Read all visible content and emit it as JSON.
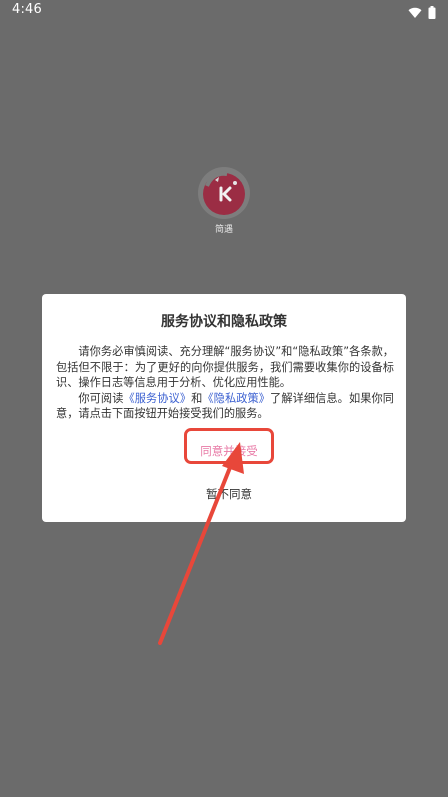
{
  "status_bar": {
    "time": "4:46",
    "icons": [
      "wifi-icon",
      "battery-icon"
    ]
  },
  "splash": {
    "app_name": "简遇",
    "logo_icon": "app-logo-icon"
  },
  "dialog": {
    "title": "服务协议和隐私政策",
    "paragraph1": "请你务必审慎阅读、充分理解“服务协议”和“隐私政策”各条款，包括但不限于：为了更好的向你提供服务，我们需要收集你的设备标识、操作日志等信息用于分析、优化应用性能。",
    "paragraph2": {
      "prefix": "你可阅读",
      "service_link": "《服务协议》",
      "conjunction": "和",
      "privacy_link": "《隐私政策》",
      "suffix": "了解详细信息。如果你同意，请点击下面按钮开始接受我们的服务。"
    },
    "accept_label": "同意并接受",
    "decline_label": "暂不同意"
  },
  "colors": {
    "overlay": "#6b6b6b",
    "link": "#3a5fd0",
    "accept": "#e87aa6",
    "annotation": "#e8473a",
    "logo": "#9b2d44"
  }
}
